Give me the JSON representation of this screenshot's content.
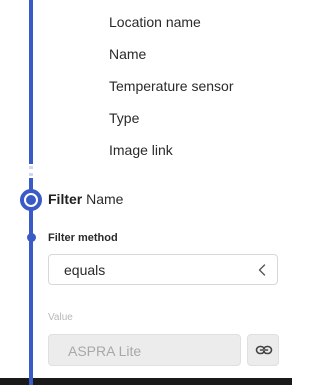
{
  "options": [
    {
      "label": "Location name"
    },
    {
      "label": "Name"
    },
    {
      "label": "Temperature sensor"
    },
    {
      "label": "Type"
    },
    {
      "label": "Image link"
    }
  ],
  "filter": {
    "title_bold": "Filter",
    "title_rest": "Name",
    "method_label": "Filter method",
    "method_value": "equals",
    "value_label": "Value",
    "value_text": "ASPRA Lite"
  },
  "icons": {
    "method_chevron": "chevron-left-icon",
    "link": "link-icon"
  },
  "colors": {
    "accent": "#3a5bc7",
    "disabled_bg": "#ececec",
    "disabled_text": "#a8a8a8"
  }
}
